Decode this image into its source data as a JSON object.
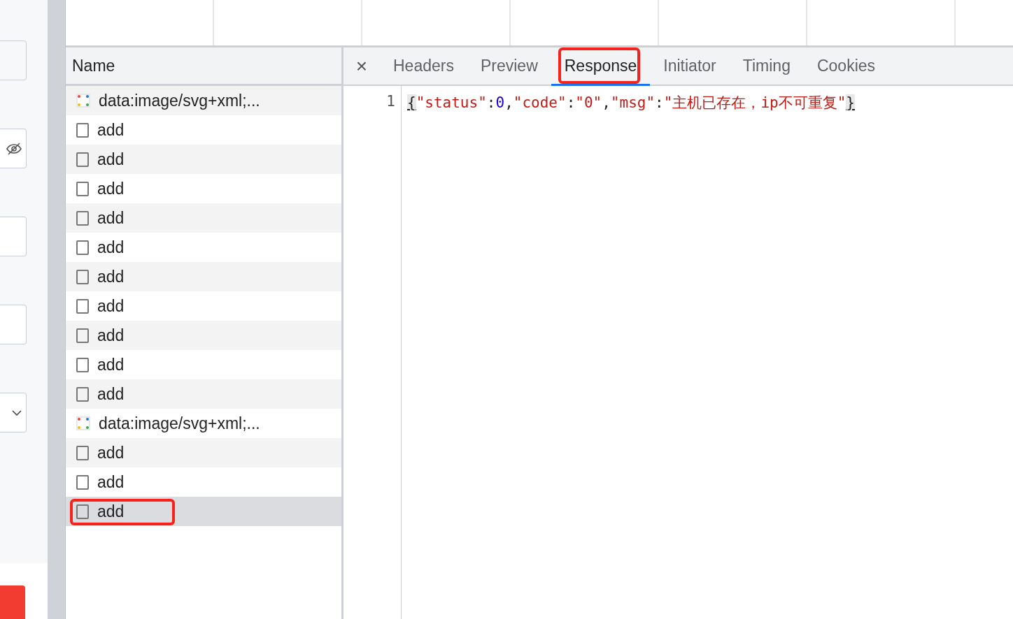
{
  "name_column": {
    "heading": "Name"
  },
  "requests": [
    {
      "kind": "image",
      "name": "data:image/svg+xml;...",
      "selected": false,
      "highlighted": false
    },
    {
      "kind": "document",
      "name": "add",
      "selected": false,
      "highlighted": false
    },
    {
      "kind": "document",
      "name": "add",
      "selected": false,
      "highlighted": false
    },
    {
      "kind": "document",
      "name": "add",
      "selected": false,
      "highlighted": false
    },
    {
      "kind": "document",
      "name": "add",
      "selected": false,
      "highlighted": false
    },
    {
      "kind": "document",
      "name": "add",
      "selected": false,
      "highlighted": false
    },
    {
      "kind": "document",
      "name": "add",
      "selected": false,
      "highlighted": false
    },
    {
      "kind": "document",
      "name": "add",
      "selected": false,
      "highlighted": false
    },
    {
      "kind": "document",
      "name": "add",
      "selected": false,
      "highlighted": false
    },
    {
      "kind": "document",
      "name": "add",
      "selected": false,
      "highlighted": false
    },
    {
      "kind": "document",
      "name": "add",
      "selected": false,
      "highlighted": false
    },
    {
      "kind": "image",
      "name": "data:image/svg+xml;...",
      "selected": false,
      "highlighted": false
    },
    {
      "kind": "document",
      "name": "add",
      "selected": false,
      "highlighted": false
    },
    {
      "kind": "document",
      "name": "add",
      "selected": false,
      "highlighted": false
    },
    {
      "kind": "document",
      "name": "add",
      "selected": true,
      "highlighted": true
    }
  ],
  "close_button": "×",
  "tabs": [
    {
      "label": "Headers",
      "selected": false,
      "highlighted": false
    },
    {
      "label": "Preview",
      "selected": false,
      "highlighted": false
    },
    {
      "label": "Response",
      "selected": true,
      "highlighted": true
    },
    {
      "label": "Initiator",
      "selected": false,
      "highlighted": false
    },
    {
      "label": "Timing",
      "selected": false,
      "highlighted": false
    },
    {
      "label": "Cookies",
      "selected": false,
      "highlighted": false
    }
  ],
  "response": {
    "line_number": "1",
    "tokens": [
      {
        "kind": "brace",
        "text": "{"
      },
      {
        "kind": "string",
        "text": "\"status\""
      },
      {
        "kind": "punct",
        "text": ":"
      },
      {
        "kind": "number",
        "text": "0"
      },
      {
        "kind": "punct",
        "text": ","
      },
      {
        "kind": "string",
        "text": "\"code\""
      },
      {
        "kind": "punct",
        "text": ":"
      },
      {
        "kind": "string",
        "text": "\"0\""
      },
      {
        "kind": "punct",
        "text": ","
      },
      {
        "kind": "string",
        "text": "\"msg\""
      },
      {
        "kind": "punct",
        "text": ":"
      },
      {
        "kind": "string",
        "text": "\"主机已存在，ip不可重复\""
      },
      {
        "kind": "brace",
        "text": "}"
      }
    ]
  }
}
